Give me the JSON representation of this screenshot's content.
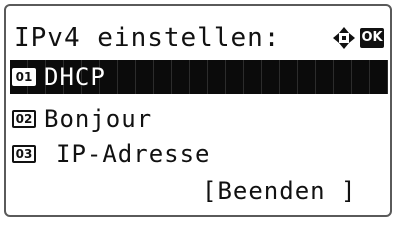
{
  "screen": {
    "title": "IPv4 einstellen:",
    "nav_icon": "four-way-arrow-icon",
    "ok_label": "OK"
  },
  "menu": {
    "items": [
      {
        "number": "01",
        "label": "DHCP",
        "selected": true
      },
      {
        "number": "02",
        "label": "Bonjour",
        "selected": false
      },
      {
        "number": "03",
        "label": "IP-Adresse",
        "selected": false
      }
    ],
    "exit_label": "[Beenden ]"
  },
  "colors": {
    "background": "#ffffff",
    "text": "#111111",
    "highlight": "#0b0b0b"
  }
}
